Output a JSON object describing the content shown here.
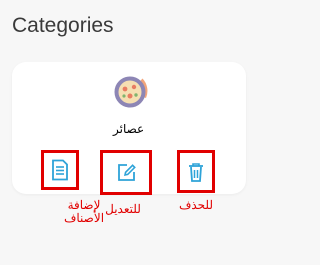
{
  "page": {
    "title": "Categories"
  },
  "card": {
    "category_name": "عصائر",
    "category_icon": "pizza-icon"
  },
  "actions": {
    "add_products": {
      "icon": "document-icon",
      "label_line1": "لإضافة",
      "label_line2": "الأصناف"
    },
    "edit": {
      "icon": "edit-icon",
      "label": "للتعديل"
    },
    "delete": {
      "icon": "trash-icon",
      "label": "للحذف"
    }
  },
  "colors": {
    "background": "#f7f7f7",
    "card": "#ffffff",
    "highlight": "#e10000",
    "icon_blue": "#2ea3d8"
  }
}
